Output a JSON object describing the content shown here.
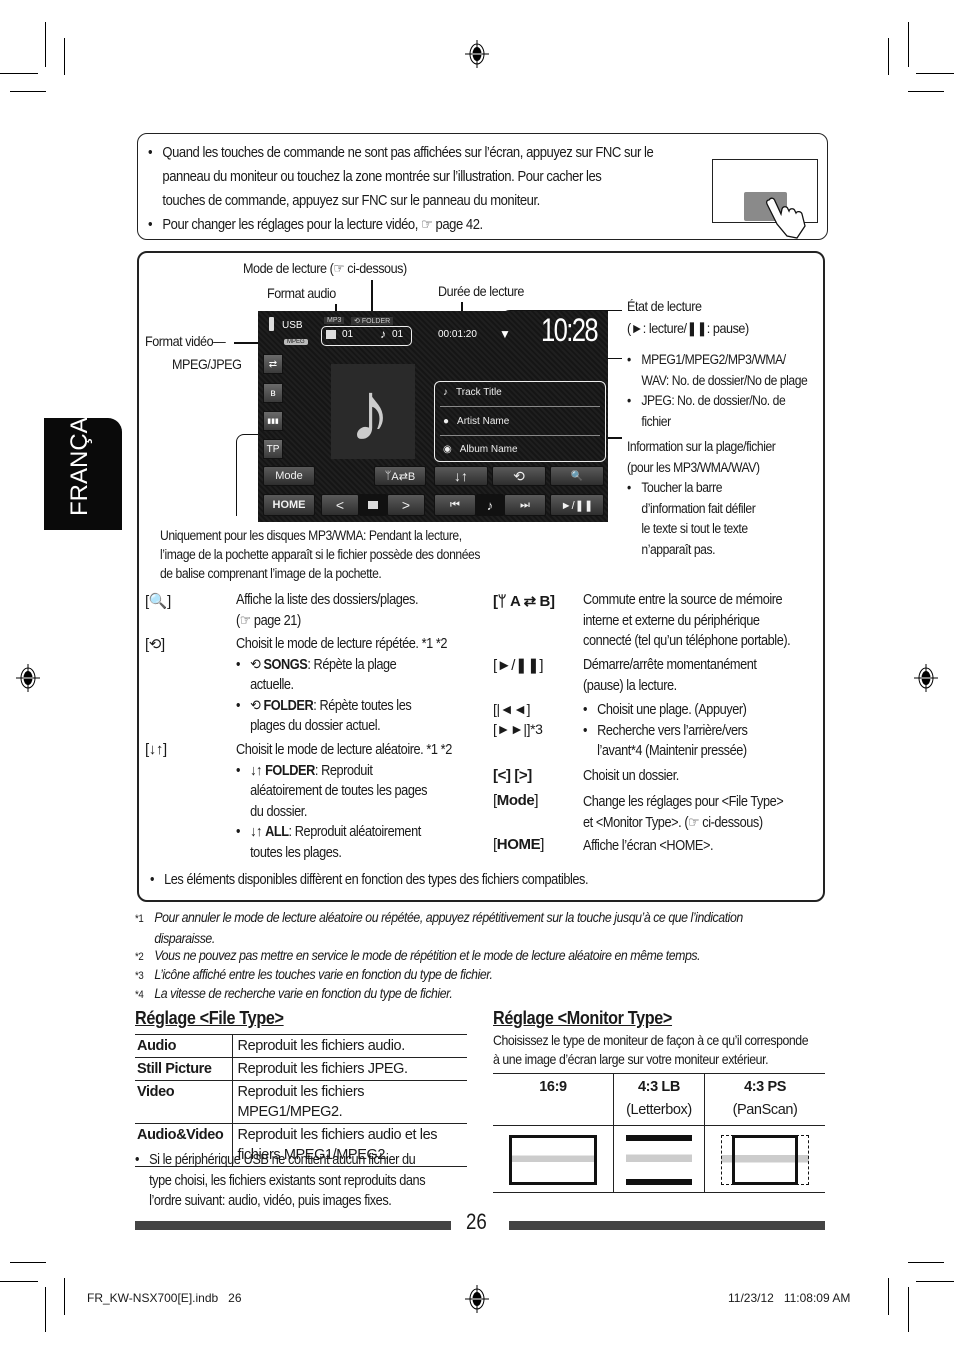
{
  "language_tab": "FRANÇAIS",
  "top_note": {
    "bullets": [
      [
        "Quand les touches de commande ne sont pas affichées sur l’écran, appuyez sur FNC sur le",
        "panneau du moniteur ou touchez la zone montrée sur l’illustration. Pour cacher les",
        "touches de commande, appuyez sur FNC sur le panneau du moniteur."
      ],
      [
        "Pour changer les réglages pour la lecture vidéo, ☞ page 42."
      ]
    ]
  },
  "callouts": {
    "mode_lecture": "Mode de lecture (☞ ci-dessous)",
    "format_audio": "Format audio",
    "duree": "Durée de lecture",
    "format_video_1": "Format vidéo—",
    "format_video_2": "MPEG/JPEG",
    "etat_1": "État de lecture",
    "etat_2": "(►: lecture/❚❚: pause)",
    "numbers": [
      "MPEG1/MPEG2/MP3/WMA/",
      "WAV: No. de dossier/No de plage",
      "JPEG: No. de dossier/No. de",
      "fichier"
    ],
    "info": [
      "Information sur la plage/fichier",
      "(pour les MP3/WMA/WAV)",
      "Toucher la barre",
      "d’information fait défiler",
      "le texte si tout le texte",
      "n’apparaît pas."
    ],
    "cover": [
      "Uniquement pour les disques MP3/WMA: Pendant la lecture,",
      "l’image de la pochette apparaît si le fichier possède des données",
      "de balise comprenant l’image de la pochette."
    ]
  },
  "screen": {
    "source": "USB",
    "video_badge": "MPEG",
    "audio_format": "MP3",
    "repeat_mode": "FOLDER",
    "folder_no": "01",
    "track_no": "01",
    "elapsed": "00:01:20",
    "clock": "10:28",
    "track_title": "Track Title",
    "artist": "Artist Name",
    "album": "Album Name",
    "side_buttons": [
      "⇄",
      "ʙ",
      "▮▮▮",
      "TP"
    ],
    "mode_btn": "Mode",
    "ab_btn": "A⇄B",
    "home_btn": "HOME",
    "shuffle_btn": "↓↑",
    "repeat_btn": "⟲",
    "search_btn": "🔍",
    "prev_folder": "<",
    "next_folder": ">",
    "prev_track": "⏮",
    "next_track": "⏭",
    "play_pause": "►/❚❚",
    "note": "♪"
  },
  "descriptions": {
    "left": [
      {
        "key": "[🔍]",
        "lines": [
          "Affiche la liste des dossiers/plages.",
          "(☞ page 21)"
        ]
      },
      {
        "key": "[⟲]",
        "lines": [
          "Choisit le mode de lecture répétée. *1 *2"
        ],
        "bullets": [
          {
            "label": "SONGS",
            "rest": ": Répète la plage",
            "cont": "actuelle."
          },
          {
            "label": "FOLDER",
            "rest": ": Répète toutes les",
            "cont": "plages du dossier actuel."
          }
        ]
      },
      {
        "key": "[↓↑]",
        "lines": [
          "Choisit le mode de lecture aléatoire. *1 *2"
        ],
        "bullets": [
          {
            "label": "FOLDER",
            "rest": ": Reproduit",
            "cont": "aléatoirement de toutes les pages",
            "cont2": "du dossier."
          },
          {
            "label": "ALL",
            "rest": ": Reproduit aléatoirement",
            "cont": "toutes les plages."
          }
        ]
      }
    ],
    "right": [
      {
        "key": "[ A ⇄ B]",
        "lines": [
          "Commute entre la source de mémoire",
          "interne et externe du périphérique",
          "connecté (tel qu’un téléphone portable)."
        ]
      },
      {
        "key": "[►/❚❚]",
        "lines": [
          "Démarre/arrête momentanément",
          "(pause) la lecture."
        ]
      },
      {
        "key": "[|◄◄]",
        "key2": "[►►|]*3",
        "bullets": [
          "Choisit une plage. (Appuyer)",
          "Recherche vers l’arrière/vers",
          "l’avant*4 (Maintenir pressée)"
        ]
      },
      {
        "key": "[<] [>]",
        "lines": [
          "Choisit un dossier."
        ]
      },
      {
        "key": "Mode",
        "lines": [
          "Change les réglages pour <File Type>",
          "et <Monitor Type>. (☞ ci-dessous)"
        ]
      },
      {
        "key": "HOME",
        "lines": [
          "Affiche l’écran <HOME>."
        ]
      }
    ],
    "bottom_note": "Les éléments disponibles diffèrent en fonction des types des fichiers compatibles."
  },
  "footnotes": [
    {
      "mark": "*1",
      "lines": [
        "Pour annuler le mode de lecture aléatoire ou répétée, appuyez répétitivement sur la touche jusqu’à ce que l’indication",
        "disparaisse."
      ]
    },
    {
      "mark": "*2",
      "lines": [
        "Vous ne pouvez pas mettre en service le mode de répétition et le mode de lecture aléatoire en même temps."
      ]
    },
    {
      "mark": "*3",
      "lines": [
        "L’icône affiché entre les touches varie en fonction du type de fichier."
      ]
    },
    {
      "mark": "*4",
      "lines": [
        "La vitesse de recherche varie en fonction du type de fichier."
      ]
    }
  ],
  "file_type": {
    "title": "Réglage <File Type>",
    "rows": [
      {
        "name": "Audio",
        "desc": "Reproduit les fichiers audio."
      },
      {
        "name": "Still Picture",
        "desc": "Reproduit les fichiers JPEG."
      },
      {
        "name": "Video",
        "desc": "Reproduit les fichiers MPEG1/MPEG2."
      },
      {
        "name": "Audio&Video",
        "desc": "Reproduit les fichiers audio et les fichiers MPEG1/MPEG2."
      }
    ],
    "note": [
      "Si le périphérique USB ne contient aucun fichier du",
      "type choisi, les fichiers existants sont reproduits dans",
      "l’ordre suivant: audio, vidéo, puis images fixes."
    ]
  },
  "monitor_type": {
    "title": "Réglage <Monitor Type>",
    "intro": [
      "Choisissez le type de moniteur de façon à ce qu’il corresponde",
      "à une image d’écran large sur votre moniteur extérieur."
    ],
    "columns": [
      {
        "label": "16:9",
        "sub": ""
      },
      {
        "label": "4:3 LB",
        "sub": "(Letterbox)"
      },
      {
        "label": "4:3 PS",
        "sub": "(PanScan)"
      }
    ]
  },
  "page_number": "26",
  "print_footer": {
    "file": "FR_KW-NSX700[E].indb   26",
    "timestamp": "11/23/12   11:08:09 AM"
  }
}
